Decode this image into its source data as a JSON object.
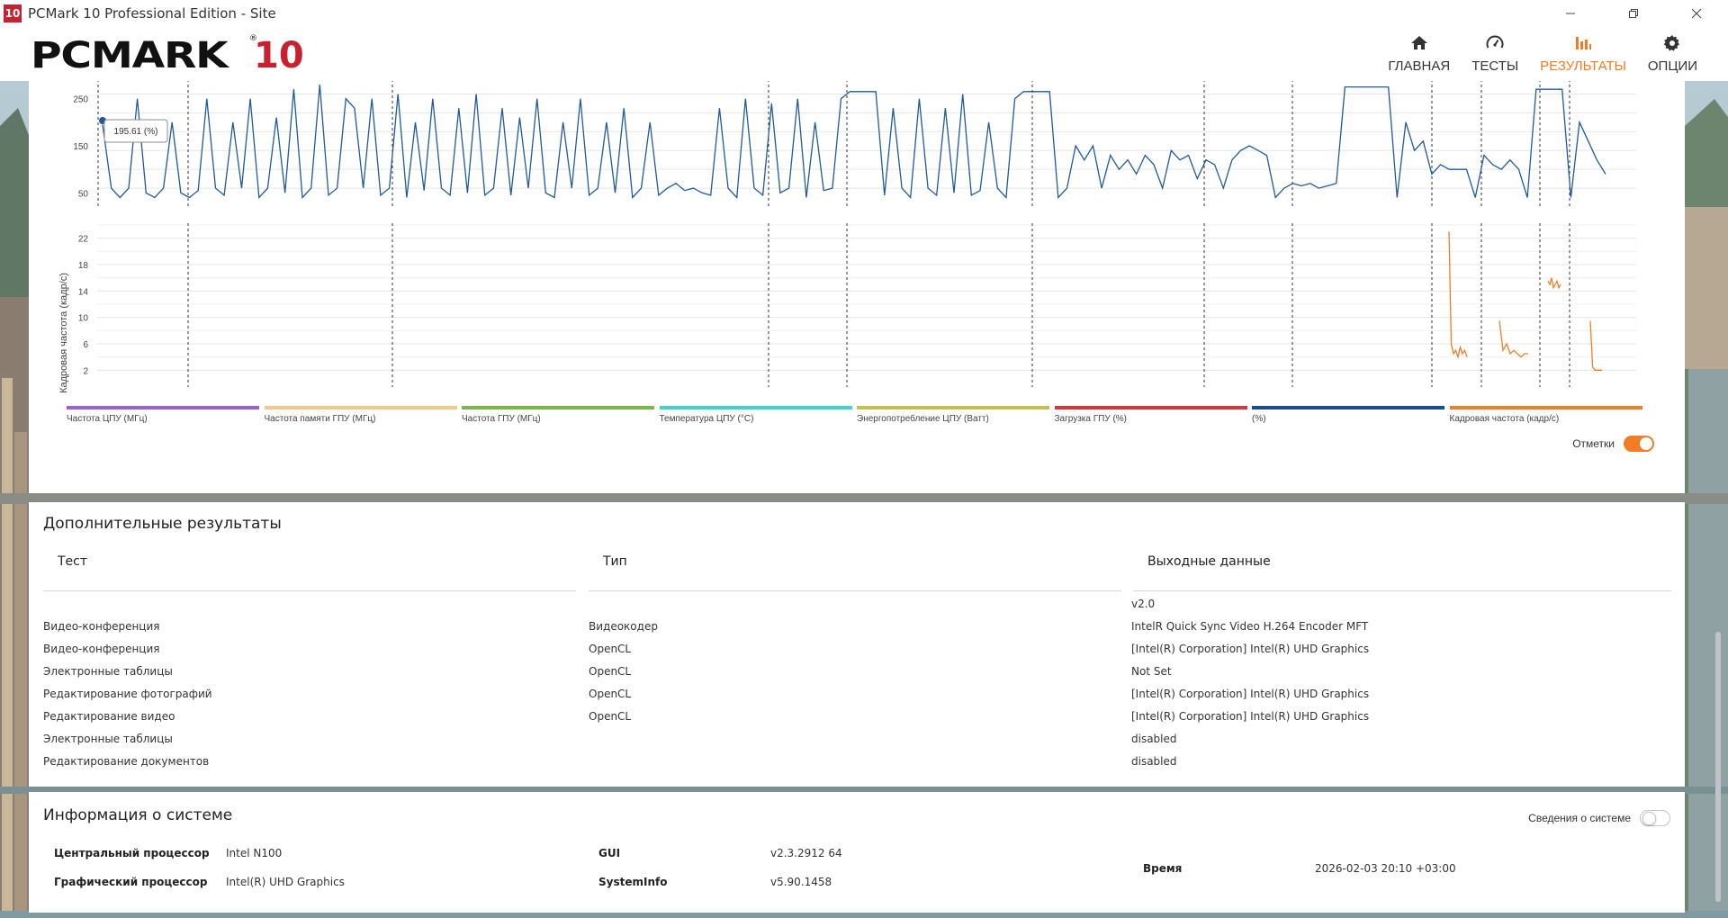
{
  "window": {
    "logo_text": "10",
    "title": "PCMark 10 Professional Edition - Site"
  },
  "header": {
    "logo_text": "PCMARK",
    "logo_number": "10",
    "logo_mark": "®",
    "nav": [
      {
        "label": "ГЛАВНАЯ",
        "icon": "home-icon",
        "active": false
      },
      {
        "label": "ТЕСТЫ",
        "icon": "gauge-icon",
        "active": false
      },
      {
        "label": "РЕЗУЛЬТАТЫ",
        "icon": "bar-chart-icon",
        "active": true
      },
      {
        "label": "ОПЦИИ",
        "icon": "gear-icon",
        "active": false
      }
    ],
    "accent_color": "#f27d24"
  },
  "chart_data": [
    {
      "type": "line",
      "title": "",
      "ylabel": "",
      "ylim": [
        20,
        280
      ],
      "yticks": [
        50,
        150,
        250
      ],
      "tooltip": "195.61 (%)",
      "series": [
        {
          "color": "#1f5a9e",
          "values": [
            195,
            60,
            40,
            60,
            250,
            50,
            40,
            60,
            200,
            50,
            40,
            55,
            250,
            60,
            45,
            200,
            60,
            250,
            40,
            60,
            210,
            50,
            270,
            40,
            60,
            280,
            45,
            60,
            250,
            230,
            60,
            250,
            45,
            60,
            260,
            40,
            200,
            55,
            250,
            60,
            45,
            230,
            50,
            260,
            45,
            60,
            230,
            45,
            210,
            60,
            250,
            50,
            40,
            200,
            60,
            250,
            45,
            60,
            200,
            50,
            230,
            40,
            60,
            200,
            45,
            60,
            70,
            55,
            60,
            50,
            45,
            230,
            60,
            40,
            250,
            60,
            45,
            240,
            50,
            60,
            250,
            40,
            200,
            55,
            60,
            250,
            265,
            265,
            265,
            265,
            45,
            230,
            60,
            40,
            250,
            60,
            45,
            230,
            50,
            260,
            45,
            55,
            200,
            60,
            40,
            250,
            265,
            265,
            265,
            265,
            40,
            60,
            150,
            120,
            150,
            60,
            130,
            100,
            120,
            90,
            130,
            110,
            60,
            140,
            120,
            130,
            80,
            120,
            110,
            60,
            120,
            140,
            150,
            140,
            130,
            40,
            60,
            70,
            65,
            70,
            60,
            65,
            70,
            275,
            275,
            275,
            275,
            275,
            275,
            40,
            200,
            140,
            160,
            90,
            110,
            100,
            100,
            100,
            40,
            130,
            110,
            100,
            120,
            100,
            40,
            270,
            270,
            270,
            270,
            40,
            200,
            160,
            120,
            90
          ]
        }
      ]
    },
    {
      "type": "line",
      "title": "",
      "ylabel": "Кадровая частота (кадр/с)",
      "ylim": [
        0,
        24
      ],
      "yticks": [
        2,
        6,
        10,
        14,
        18,
        22
      ],
      "series": [
        {
          "color": "#f27d24",
          "segments": [
            [
              23,
              6,
              4.5,
              5,
              4,
              5.5,
              4.5,
              5,
              4
            ],
            [
              9.5,
              5,
              6,
              4.5,
              5,
              4.5,
              4,
              4.5,
              4.5
            ],
            [
              15.5,
              15,
              16,
              14.5,
              15,
              15.5,
              14.5,
              15
            ],
            [
              9.5,
              2.5,
              2,
              2,
              2,
              2
            ]
          ]
        }
      ]
    }
  ],
  "legend": [
    {
      "label": "Частота ЦПУ (МГц)",
      "color": "#9b5fd6"
    },
    {
      "label": "Частота памяти ГПУ (МГц)",
      "color": "#f3c98a"
    },
    {
      "label": "Частота ГПУ (МГц)",
      "color": "#7ab648"
    },
    {
      "label": "Температура ЦПУ (°С)",
      "color": "#3ed6c5"
    },
    {
      "label": "Энергопотребление ЦПУ (Ватт)",
      "color": "#c4c24a"
    },
    {
      "label": "Загрузка ГПУ (%)",
      "color": "#d8363a"
    },
    {
      "label": "(%)",
      "color": "#1a4a9c"
    },
    {
      "label": "Кадровая частота (кадр/с)",
      "color": "#f27d24"
    }
  ],
  "marks_toggle": {
    "label": "Отметки",
    "on": true
  },
  "results": {
    "title": "Дополнительные результаты",
    "columns": [
      "Тест",
      "Тип",
      "Выходные данные"
    ],
    "version": "v2.0",
    "rows": [
      [
        "Видео-конференция",
        "Видеокодер",
        "IntelR Quick Sync Video H.264 Encoder MFT"
      ],
      [
        "Видео-конференция",
        "OpenCL",
        "[Intel(R) Corporation] Intel(R) UHD Graphics"
      ],
      [
        "Электронные таблицы",
        "OpenCL",
        "Not Set"
      ],
      [
        "Редактирование фотографий",
        "OpenCL",
        "[Intel(R) Corporation] Intel(R) UHD Graphics"
      ],
      [
        "Редактирование видео",
        "OpenCL",
        "[Intel(R) Corporation] Intel(R) UHD Graphics"
      ],
      [
        "Электронные таблицы",
        "",
        "disabled"
      ],
      [
        "Редактирование документов",
        "",
        "disabled"
      ]
    ]
  },
  "system": {
    "title": "Информация о системе",
    "toggle_label": "Сведения о системе",
    "toggle_on": false,
    "cpu_label": "Центральный процессор",
    "cpu_value": "Intel N100",
    "gpu_label": "Графический процессор",
    "gpu_value": "Intel(R) UHD Graphics",
    "gui_label": "GUI",
    "gui_value": "v2.3.2912 64",
    "sysinfo_label": "SystemInfo",
    "sysinfo_value": "v5.90.1458",
    "time_label": "Время",
    "time_value": "2026-02-03 20:10 +03:00"
  }
}
